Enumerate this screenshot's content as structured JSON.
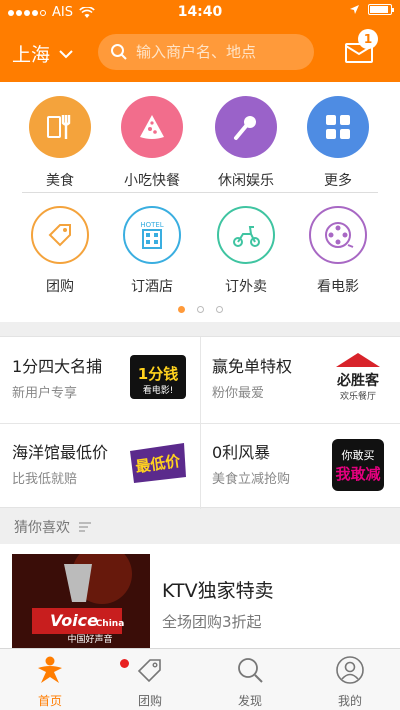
{
  "status_bar": {
    "carrier": "AIS",
    "time": "14:40"
  },
  "header": {
    "city": "上海",
    "search_placeholder": "输入商户名、地点",
    "message_badge": "1",
    "accent": "#ff7d00"
  },
  "categories_row1": [
    {
      "label": "美食",
      "icon": "utensils-icon",
      "color": "#f4a33c"
    },
    {
      "label": "小吃快餐",
      "icon": "pizza-icon",
      "color": "#f26d8c"
    },
    {
      "label": "休闲娱乐",
      "icon": "microphone-icon",
      "color": "#9a62c9"
    },
    {
      "label": "更多",
      "icon": "grid-icon",
      "color": "#4e8ce3"
    }
  ],
  "categories_row2": [
    {
      "label": "团购",
      "icon": "tag-icon",
      "color": "#f4a33c"
    },
    {
      "label": "订酒店",
      "icon": "hotel-icon",
      "color": "#3aaee0",
      "icon_text": "HOTEL"
    },
    {
      "label": "订外卖",
      "icon": "scooter-icon",
      "color": "#3fc4a1"
    },
    {
      "label": "看电影",
      "icon": "film-reel-icon",
      "color": "#a868c4"
    }
  ],
  "pager": {
    "pages": 3,
    "active": 0
  },
  "promos": [
    {
      "title": "1分四大名捕",
      "subtitle": "新用户专享",
      "img_text": "1分钱",
      "img_sub": "看电影!"
    },
    {
      "title": "赢免单特权",
      "subtitle": "粉你最爱",
      "img_text": "必胜客",
      "img_sub": "欢乐餐厅"
    },
    {
      "title": "海洋馆最低价",
      "subtitle": "比我低就赔",
      "img_text": "最低价"
    },
    {
      "title": "0利风暴",
      "subtitle": "美食立减抢购",
      "img_text": "你敢买",
      "img_sub": "我敢减"
    }
  ],
  "guess": {
    "header": "猜你喜欢",
    "items": [
      {
        "title": "KTV独家特卖",
        "subtitle": "全场团购3折起",
        "thumb_text": "Voice",
        "thumb_sub": "China",
        "thumb_tag": "中国好声音"
      }
    ]
  },
  "tabbar": [
    {
      "label": "首页",
      "icon": "home-person-icon",
      "active": true
    },
    {
      "label": "团购",
      "icon": "tag-icon",
      "badge_dot": true
    },
    {
      "label": "发现",
      "icon": "search-icon"
    },
    {
      "label": "我的",
      "icon": "user-icon"
    }
  ]
}
